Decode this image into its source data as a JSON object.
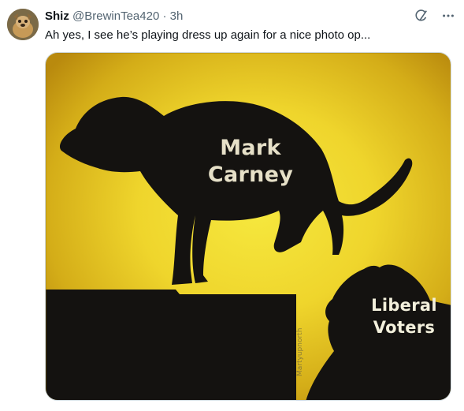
{
  "tweet": {
    "author_name": "Shiz",
    "author_handle": "@BrewinTea420",
    "separator": "·",
    "time": "3h",
    "text": "Ah yes, I see he’s playing dress up again for a nice photo op...",
    "icons": {
      "grok": "grok-icon",
      "more": "more-options-icon"
    }
  },
  "media": {
    "label_top": "Mark\nCarney",
    "label_top_line1": "Mark",
    "label_top_line2": "Carney",
    "label_bottom_line1": "Liberal",
    "label_bottom_line2": "Voters",
    "watermark": "Martyupnorth",
    "colors": {
      "glow": "#f4e23a",
      "dark_yellow": "#c29a12",
      "silhouette": "#141210"
    }
  }
}
